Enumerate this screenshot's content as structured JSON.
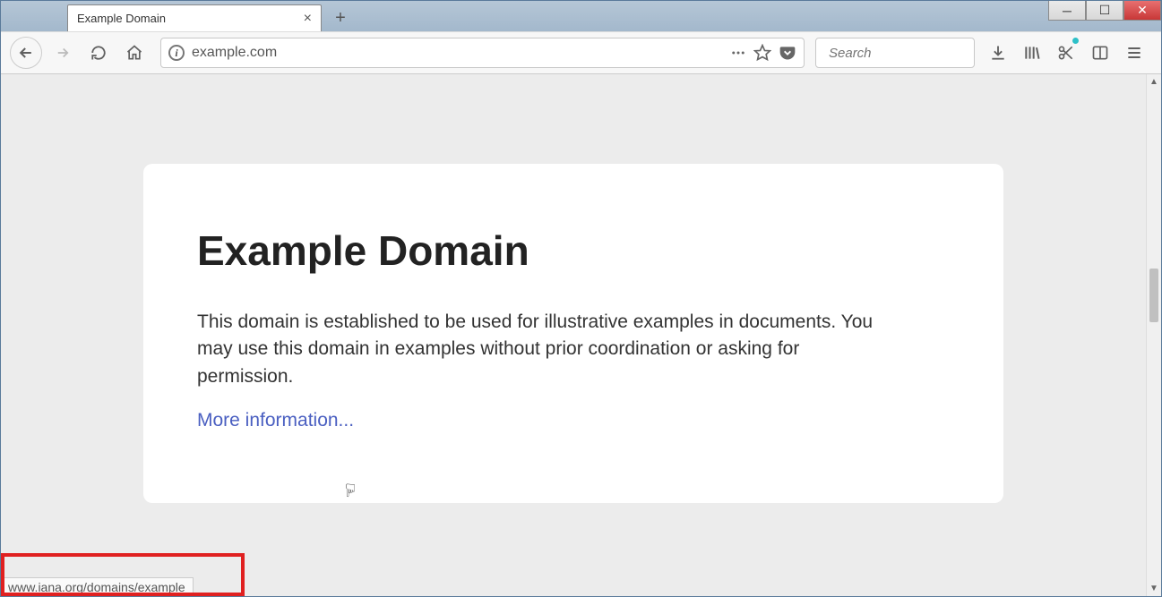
{
  "window": {
    "controls": {
      "minimize": "─",
      "maximize": "☐",
      "close": "✕"
    }
  },
  "tab": {
    "title": "Example Domain"
  },
  "navbar": {
    "url": "example.com",
    "search_placeholder": "Search"
  },
  "page": {
    "heading": "Example Domain",
    "paragraph": "This domain is established to be used for illustrative examples in documents. You may use this domain in examples without prior coordination or asking for permission.",
    "link_text": "More information..."
  },
  "status": {
    "hover_url": "www.iana.org/domains/example"
  }
}
